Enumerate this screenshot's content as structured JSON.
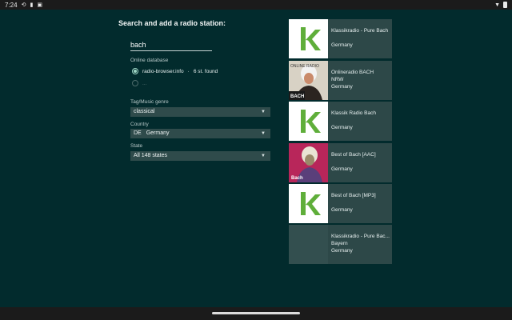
{
  "statusbar": {
    "time": "7:24",
    "left_icons": [
      "sync-icon",
      "clipboard-icon",
      "screenshot-icon"
    ],
    "right_icons": [
      "wifi-icon",
      "battery-icon"
    ]
  },
  "heading": "Search and add a radio station:",
  "search": {
    "value": "bach"
  },
  "online_database": {
    "label": "Online database",
    "option1": "radio-browser.info",
    "found": "6 st. found",
    "option2": "..."
  },
  "filters": {
    "genre_label": "Tag/Music genre",
    "genre_value": "classical",
    "country_label": "Country",
    "country_code": "DE",
    "country_value": "Germany",
    "state_label": "State",
    "state_value": "All 148 states"
  },
  "results": [
    {
      "lines": [
        "Klassikradio - Pure Bach",
        "",
        "Germany"
      ]
    },
    {
      "lines": [
        "Onlineradio BACH",
        "NRW",
        "Germany"
      ]
    },
    {
      "lines": [
        "Klassik Radio Bach",
        "",
        "Germany"
      ]
    },
    {
      "lines": [
        "Best of Bach [AAC]",
        "",
        "Germany"
      ]
    },
    {
      "lines": [
        "Best of Bach [MP3]",
        "",
        "Germany"
      ]
    },
    {
      "lines": [
        "Klassikradio - Pure Bac...",
        "Bayern",
        "Germany"
      ]
    }
  ],
  "thumb_text": {
    "onlineradio_top": "ONLINE RADIO",
    "onlineradio_bottom": "BACH",
    "bestof": "Bach"
  }
}
